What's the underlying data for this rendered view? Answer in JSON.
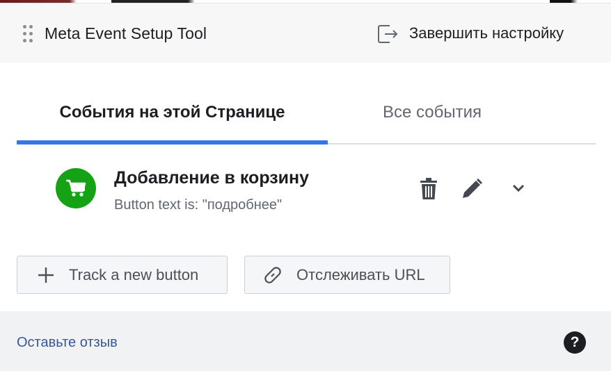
{
  "header": {
    "app_title": "Meta Event Setup Tool",
    "finish_label": "Завершить настройку"
  },
  "tabs": [
    {
      "label": "События на этой Странице",
      "active": true
    },
    {
      "label": "Все события",
      "active": false
    }
  ],
  "event": {
    "title": "Добавление в корзину",
    "subtitle": "Button text is: \"подробнее\"",
    "icon": "shopping-cart-icon",
    "icon_bg_color": "#15a215"
  },
  "buttons": {
    "track_new": "Track a new button",
    "track_url": "Отслеживать URL"
  },
  "footer": {
    "feedback_link": "Оставьте отзыв",
    "help_glyph": "?"
  },
  "colors": {
    "accent": "#3578e5",
    "link": "#365899",
    "success": "#15a215"
  }
}
